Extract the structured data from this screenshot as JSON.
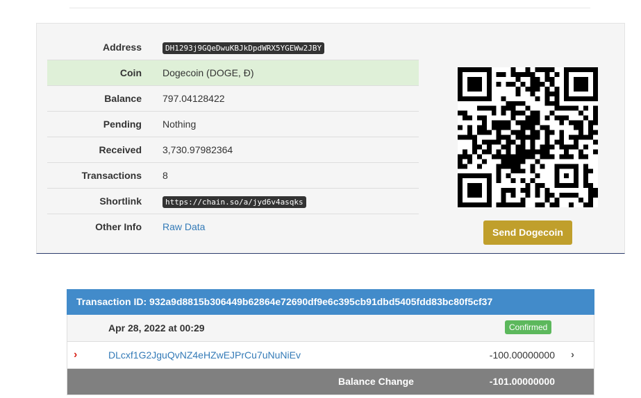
{
  "address": {
    "label": "Address",
    "value": "DH1293j9GQeDwuKBJkDpdWRX5YGEWw2JBY"
  },
  "coin": {
    "label": "Coin",
    "value": "Dogecoin (DOGE, Đ)"
  },
  "balance": {
    "label": "Balance",
    "value": "797.04128422"
  },
  "pending": {
    "label": "Pending",
    "value": "Nothing"
  },
  "received": {
    "label": "Received",
    "value": "3,730.97982364"
  },
  "transactions": {
    "label": "Transactions",
    "value": "8"
  },
  "shortlink": {
    "label": "Shortlink",
    "value": "https://chain.so/a/jyd6v4asqks"
  },
  "other_info": {
    "label": "Other Info",
    "link": "Raw Data"
  },
  "send_button": "Send Dogecoin",
  "transaction": {
    "header": "Transaction ID: 932a9d8815b306449b62864e72690df9e6c395cb91dbd5405fdd83bc80f5cf37",
    "date": "Apr 28, 2022 at 00:29",
    "status": "Confirmed",
    "io_address": "DLcxf1G2JguQvNZ4eHZwEJPrCu7uNuNiEv",
    "io_amount": "-100.00000000",
    "balance_change_label": "Balance Change",
    "balance_change_value": "-101.00000000"
  },
  "icons": {
    "qr": "qr-code",
    "input_marker": "chevron-right-icon",
    "details": "chevron-right-icon"
  },
  "colors": {
    "tx_header": "#428bca",
    "confirmed": "#5cb85c",
    "send_button": "#c09f2c",
    "highlight_row": "#dff0d8",
    "balance_row": "#808080"
  }
}
